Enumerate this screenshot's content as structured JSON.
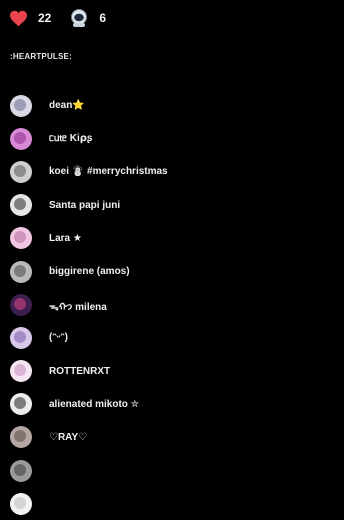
{
  "reactions": [
    {
      "icon": "heart-icon",
      "count": "22",
      "color": "#e8454f"
    },
    {
      "icon": "astronaut-emoji-icon",
      "count": "6",
      "color": "#c9d6e3"
    }
  ],
  "section_title": ":HEARTPULSE:",
  "users": [
    {
      "name": "dean⭐",
      "avatar_bg": "#d9d9e6",
      "avatar_fg": "#6b6b8c"
    },
    {
      "name": "ᥴᥙ𝗍ᥱ Ki⍴ʂ",
      "avatar_bg": "#d98ad6",
      "avatar_fg": "#8a2c8a"
    },
    {
      "name": "koei ☃️ #merrychristmas",
      "avatar_bg": "#cfcfcf",
      "avatar_fg": "#555555"
    },
    {
      "name": "Santa papi juni",
      "avatar_bg": "#e5e5e5",
      "avatar_fg": "#2a2a2a"
    },
    {
      "name": "Lara ★",
      "avatar_bg": "#f1c6e3",
      "avatar_fg": "#b46a9a"
    },
    {
      "name": "biggirene (amos)",
      "avatar_bg": "#b9b9b9",
      "avatar_fg": "#4a4a4a"
    },
    {
      "name": "ᯓᡣ𐭩            milena",
      "avatar_bg": "#3c1f4f",
      "avatar_fg": "#e0458c"
    },
    {
      "name": "(ᵔᵕᵔ)",
      "avatar_bg": "#d8c9ea",
      "avatar_fg": "#7a5aa8"
    },
    {
      "name": "ROTTENRXT",
      "avatar_bg": "#f4e6f2",
      "avatar_fg": "#c48ab8"
    },
    {
      "name": "alienated mikoto ✮",
      "avatar_bg": "#ededed",
      "avatar_fg": "#1f1f1f"
    },
    {
      "name": "♡RAY♡",
      "avatar_bg": "#b3a7a3",
      "avatar_fg": "#5c4b45"
    },
    {
      "name": "",
      "avatar_bg": "#9a9a9a",
      "avatar_fg": "#3a3a3a"
    },
    {
      "name": "",
      "avatar_bg": "#f2f2f2",
      "avatar_fg": "#bbbbbb"
    }
  ]
}
